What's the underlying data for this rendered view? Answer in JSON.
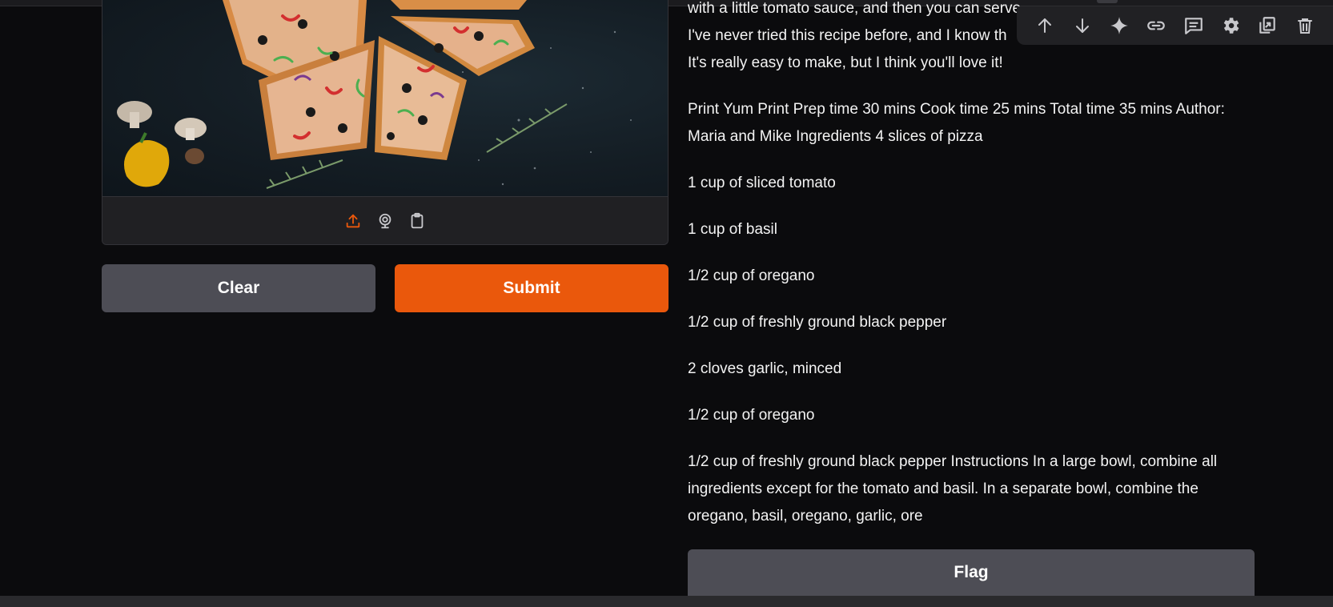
{
  "window": {
    "title": ""
  },
  "image_panel": {
    "toolbar": [
      {
        "icon": "upload-icon",
        "color": "#ea580c"
      },
      {
        "icon": "webcam-icon",
        "color": "#c8c8cc"
      },
      {
        "icon": "clipboard-icon",
        "color": "#c8c8cc"
      }
    ]
  },
  "buttons": {
    "clear_label": "Clear",
    "submit_label": "Submit",
    "flag_label": "Flag"
  },
  "output": {
    "line1": "with a little tomato sauce, and then you can serve",
    "line2": "I've never tried this recipe before, and I know th",
    "line3": "It's really easy to make, but I think you'll love it!",
    "para_meta_1": "Print Yum Print Prep time 30 mins Cook time 25 mins Total time 35 mins Author:",
    "para_meta_2": "Maria and Mike Ingredients 4 slices of pizza",
    "ingredients": [
      "1 cup of sliced tomato",
      "1 cup of basil",
      "1/2 cup of oregano",
      "1/2 cup of freshly ground black pepper",
      "2 cloves garlic, minced",
      "1/2 cup of oregano"
    ],
    "instructions_1": "1/2 cup of freshly ground black pepper Instructions In a large bowl, combine all",
    "instructions_2": "ingredients except for the tomato and basil. In a separate bowl, combine the",
    "instructions_3": "oregano, basil, oregano, garlic, ore"
  },
  "action_bar": {
    "icons": [
      "arrow-up-icon",
      "arrow-down-icon",
      "sparkle-icon",
      "link-icon",
      "comment-icon",
      "gear-icon",
      "copy-to-icon",
      "trash-icon"
    ]
  },
  "colors": {
    "accent": "#ea580c",
    "button_secondary": "#4d4d55",
    "background": "#0b0b0d"
  }
}
